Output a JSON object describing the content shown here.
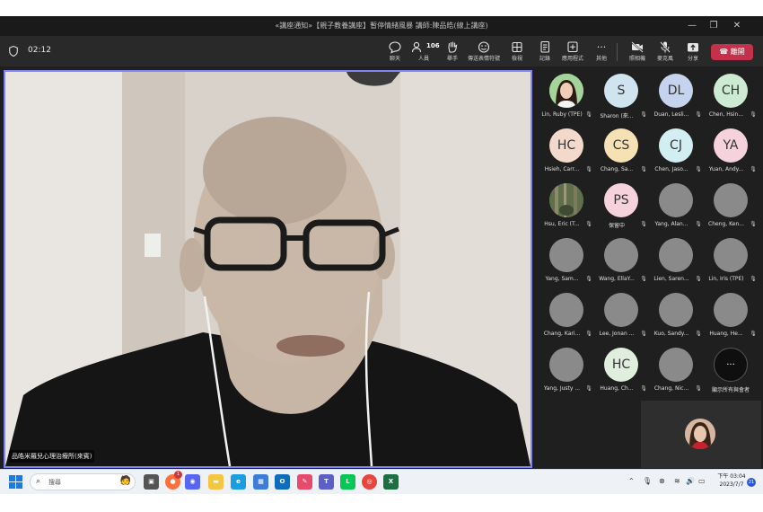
{
  "window": {
    "title": "«講座通知»【親子教養講座】暫停情緒風暴 講師:陳品皓(線上講座)",
    "minimize_glyph": "—",
    "maximize_glyph": "❐",
    "close_glyph": "✕"
  },
  "toolbar": {
    "timer": "02:12",
    "people_count": "106",
    "buttons": [
      {
        "name": "chat",
        "label": "聊天",
        "icon": "chat-icon"
      },
      {
        "name": "people",
        "label": "人員",
        "icon": "people-icon"
      },
      {
        "name": "raise-hand",
        "label": "舉手",
        "icon": "hand-icon"
      },
      {
        "name": "react",
        "label": "傳送表情符號",
        "icon": "emoji-icon"
      },
      {
        "name": "view",
        "label": "檢視",
        "icon": "grid-icon"
      },
      {
        "name": "notes",
        "label": "記錄",
        "icon": "notes-icon"
      },
      {
        "name": "apps",
        "label": "應用程式",
        "icon": "apps-icon"
      },
      {
        "name": "more",
        "label": "其他",
        "icon": "more-icon"
      },
      {
        "name": "camera",
        "label": "照相機",
        "icon": "camera-off-icon"
      },
      {
        "name": "mic",
        "label": "麥克風",
        "icon": "mic-off-icon"
      },
      {
        "name": "share",
        "label": "分享",
        "icon": "share-icon"
      }
    ],
    "leave_label": "離開"
  },
  "main_video": {
    "speaker_name": "品皓米羅兒心理治療所(來賓)"
  },
  "participants": [
    {
      "name": "Lin, Ruby (TPE)",
      "initials": "",
      "type": "photo1",
      "color": "#9ccf9a"
    },
    {
      "name": "Sharon (來...",
      "initials": "S",
      "type": "initials",
      "color": "#cfe4ef"
    },
    {
      "name": "Duan, Lesli...",
      "initials": "DL",
      "type": "initials",
      "color": "#c5d3ee"
    },
    {
      "name": "Chen, Hsin...",
      "initials": "CH",
      "type": "initials",
      "color": "#cdebd3"
    },
    {
      "name": "Hsieh, Carr...",
      "initials": "HC",
      "type": "initials",
      "color": "#f3d9cc"
    },
    {
      "name": "Chang, Sa...",
      "initials": "CS",
      "type": "initials",
      "color": "#f6e1b5"
    },
    {
      "name": "Chen, Jaso...",
      "initials": "CJ",
      "type": "initials",
      "color": "#d2eef2"
    },
    {
      "name": "Yuan, Andy...",
      "initials": "YA",
      "type": "initials",
      "color": "#f5d2dc"
    },
    {
      "name": "Hsu, Eric (T...",
      "initials": "",
      "type": "photo2",
      "color": "#6e7d5a"
    },
    {
      "name": "保留中",
      "initials": "PS",
      "type": "initials",
      "color": "#f5d2dc"
    },
    {
      "name": "Yang, Alan...",
      "initials": "",
      "type": "gray",
      "color": "#8a8a8a"
    },
    {
      "name": "Cheng, Ken...",
      "initials": "",
      "type": "gray",
      "color": "#8a8a8a"
    },
    {
      "name": "Yang, Sam...",
      "initials": "",
      "type": "gray",
      "color": "#8a8a8a"
    },
    {
      "name": "Wang, EllaY...",
      "initials": "",
      "type": "gray",
      "color": "#8a8a8a"
    },
    {
      "name": "Lien, Saren...",
      "initials": "",
      "type": "gray",
      "color": "#8a8a8a"
    },
    {
      "name": "Lin, Iris (TPE)",
      "initials": "",
      "type": "gray",
      "color": "#8a8a8a"
    },
    {
      "name": "Chang, Kari...",
      "initials": "",
      "type": "gray",
      "color": "#8a8a8a"
    },
    {
      "name": "Lee, Jonan ...",
      "initials": "",
      "type": "gray",
      "color": "#8a8a8a"
    },
    {
      "name": "Kuo, Sandy...",
      "initials": "",
      "type": "gray",
      "color": "#8a8a8a"
    },
    {
      "name": "Huang, He...",
      "initials": "",
      "type": "gray",
      "color": "#8a8a8a"
    },
    {
      "name": "Yang, Justy ...",
      "initials": "",
      "type": "gray",
      "color": "#8a8a8a"
    },
    {
      "name": "Huang, Ch...",
      "initials": "HC",
      "type": "initials",
      "color": "#dfeedd"
    },
    {
      "name": "Chang, Nic...",
      "initials": "",
      "type": "gray",
      "color": "#8a8a8a"
    },
    {
      "name": "顯示所有與會者",
      "initials": "···",
      "type": "more",
      "color": "#0f0f0f"
    }
  ],
  "taskbar": {
    "search_placeholder": "搜尋",
    "apps": [
      {
        "name": "task-view",
        "glyph": "▣",
        "color": "#555555"
      },
      {
        "name": "firefox",
        "glyph": "●",
        "color": "#ff7139"
      },
      {
        "name": "discord",
        "glyph": "◉",
        "color": "#5865f2"
      },
      {
        "name": "file-explorer",
        "glyph": "▬",
        "color": "#f4c542"
      },
      {
        "name": "edge",
        "glyph": "e",
        "color": "#1b9de2"
      },
      {
        "name": "store",
        "glyph": "▦",
        "color": "#3b7dd8"
      },
      {
        "name": "outlook",
        "glyph": "O",
        "color": "#0f6cbd"
      },
      {
        "name": "paint",
        "glyph": "✎",
        "color": "#e84a6b"
      },
      {
        "name": "teams",
        "glyph": "T",
        "color": "#5b5fc7"
      },
      {
        "name": "line",
        "glyph": "L",
        "color": "#06c755"
      },
      {
        "name": "chrome",
        "glyph": "◎",
        "color": "#e8453c"
      },
      {
        "name": "excel",
        "glyph": "X",
        "color": "#1d6f42"
      }
    ],
    "firefox_badge": "1",
    "clock_period_time": "下午 03:04",
    "clock_date": "2023/7/7",
    "notification_count": "21"
  }
}
